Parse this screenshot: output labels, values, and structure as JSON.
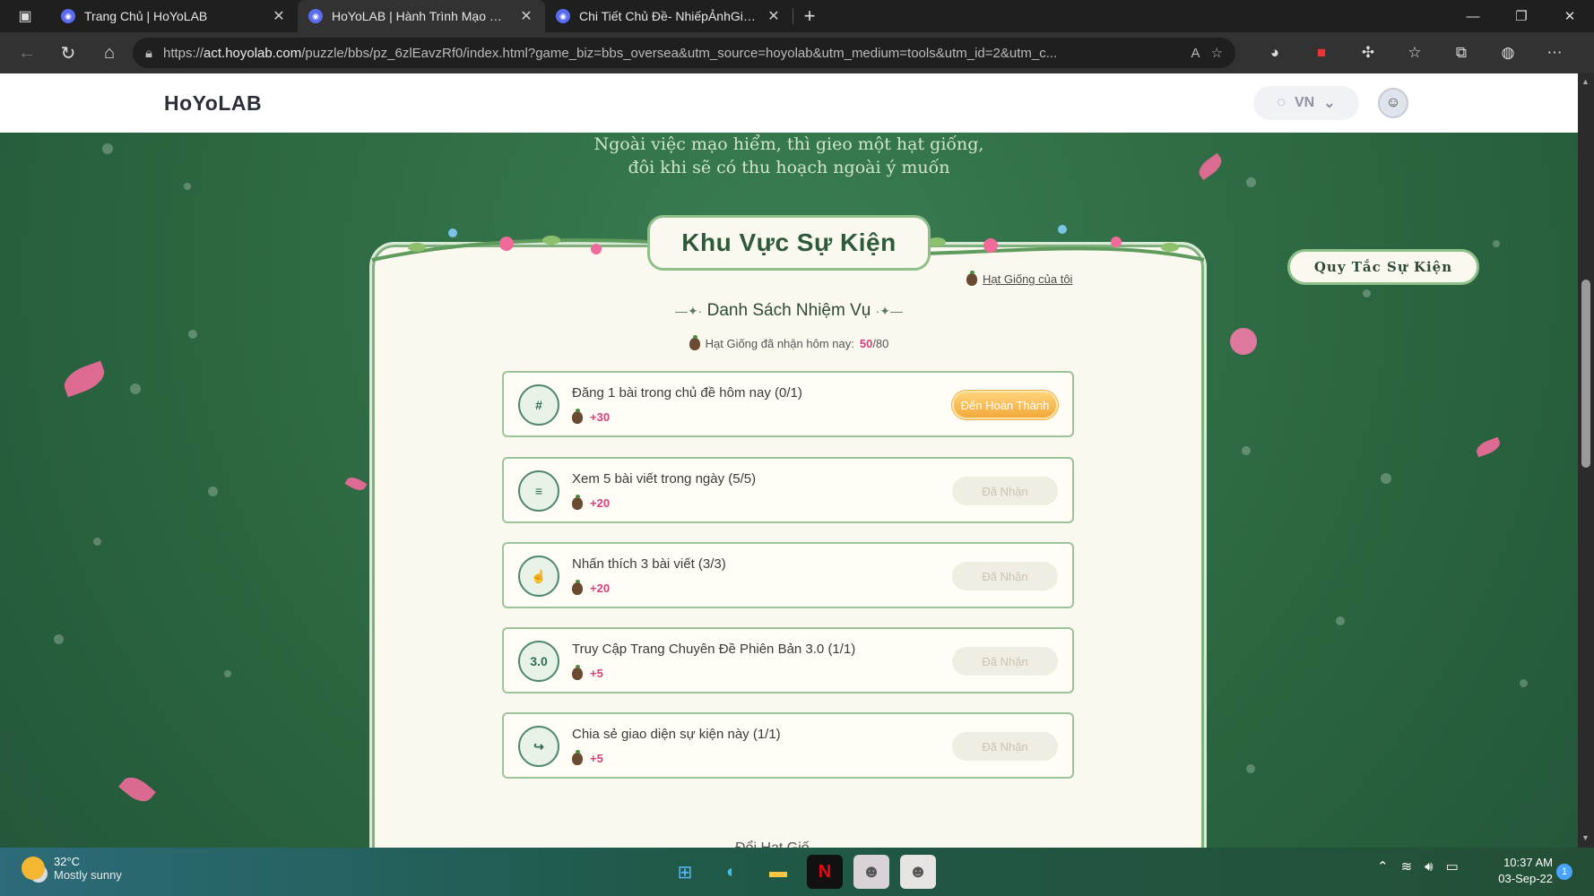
{
  "browser": {
    "tabs": [
      {
        "title": "Trang Chủ | HoYoLAB",
        "active": false
      },
      {
        "title": "HoYoLAB | Hành Trình Mạo Hiểm",
        "active": true
      },
      {
        "title": "Chi Tiết Chủ Đề- NhiếpẢnhGiaTe",
        "active": false
      }
    ],
    "url_prefix": "https://",
    "url_host": "act.hoyolab.com",
    "url_rest": "/puzzle/bbs/pz_6zlEavzRf0/index.html?game_biz=bbs_oversea&utm_source=hoyolab&utm_medium=tools&utm_id=2&utm_c..."
  },
  "site": {
    "logo": "HoYoLAB",
    "lang": "VN"
  },
  "event": {
    "tagline_1": "Ngoài việc mạo hiểm, thì gieo một hạt giống,",
    "tagline_2": "đôi khi sẽ có thu hoạch ngoài ý muốn",
    "title": "Khu Vực Sự Kiện",
    "my_seeds": "Hạt Giống của tôi",
    "list_title": "Danh Sách Nhiệm Vụ",
    "today_label": "Hạt Giống đã nhận hôm nay:",
    "today_count": "50",
    "today_total": "/80",
    "rules_button": "Quy Tắc Sự Kiện",
    "next_section": "Đổi Hạt Giố..."
  },
  "tasks": [
    {
      "name": "Đăng 1 bài trong chủ đề hôm nay (0/1)",
      "reward": "+30",
      "button": "Đến Hoàn Thành",
      "state": "todo",
      "icon": "#"
    },
    {
      "name": "Xem 5 bài viết trong ngày (5/5)",
      "reward": "+20",
      "button": "Đã Nhận",
      "state": "done",
      "icon": "≡"
    },
    {
      "name": "Nhấn thích 3 bài viết (3/3)",
      "reward": "+20",
      "button": "Đã Nhận",
      "state": "done",
      "icon": "☝"
    },
    {
      "name": "Truy Cập Trang Chuyên Đề Phiên Bản 3.0 (1/1)",
      "reward": "+5",
      "button": "Đã Nhận",
      "state": "done",
      "icon": "3.0"
    },
    {
      "name": "Chia sẻ giao diện sự kiện này (1/1)",
      "reward": "+5",
      "button": "Đã Nhận",
      "state": "done",
      "icon": "↪"
    }
  ],
  "taskbar": {
    "temp": "32°C",
    "condition": "Mostly sunny",
    "time": "10:37 AM",
    "date": "03-Sep-22",
    "notifications": "1"
  }
}
